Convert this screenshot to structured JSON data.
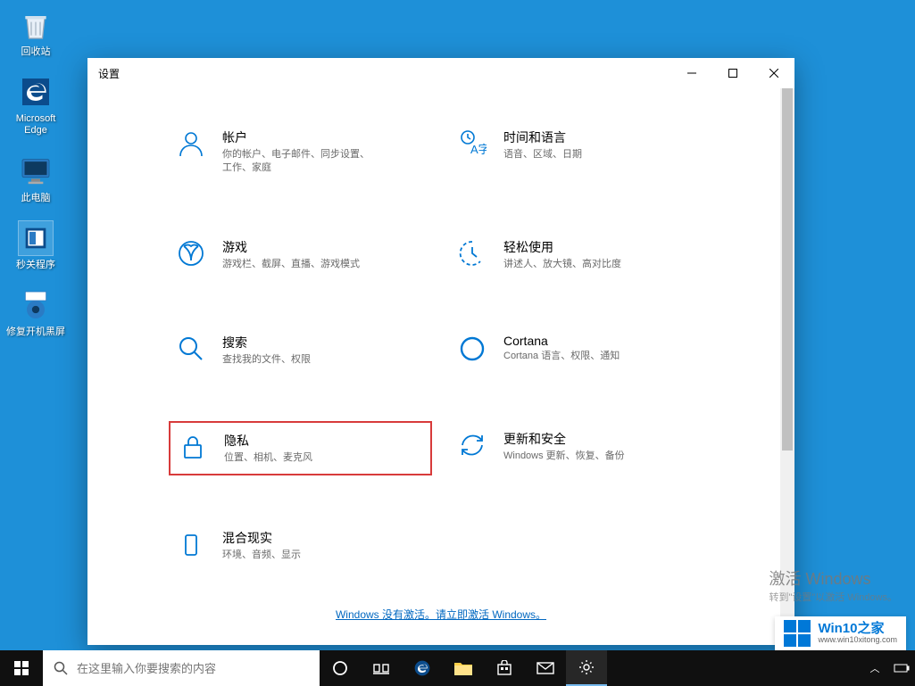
{
  "desktop": {
    "icons": [
      {
        "label": "回收站",
        "name": "recycle-bin"
      },
      {
        "label": "Microsoft\nEdge",
        "name": "edge"
      },
      {
        "label": "此电脑",
        "name": "this-pc"
      },
      {
        "label": "秒关程序",
        "name": "quick-close"
      },
      {
        "label": "修复开机黑屏",
        "name": "repair-boot"
      }
    ]
  },
  "settings": {
    "title": "设置",
    "categories": [
      {
        "title": "帐户",
        "desc": "你的帐户、电子邮件、同步设置、工作、家庭"
      },
      {
        "title": "时间和语言",
        "desc": "语音、区域、日期"
      },
      {
        "title": "游戏",
        "desc": "游戏栏、截屏、直播、游戏模式"
      },
      {
        "title": "轻松使用",
        "desc": "讲述人、放大镜、高对比度"
      },
      {
        "title": "搜索",
        "desc": "查找我的文件、权限"
      },
      {
        "title": "Cortana",
        "desc": "Cortana 语言、权限、通知"
      },
      {
        "title": "隐私",
        "desc": "位置、相机、麦克风"
      },
      {
        "title": "更新和安全",
        "desc": "Windows 更新、恢复、备份"
      },
      {
        "title": "混合现实",
        "desc": "环境、音频、显示"
      }
    ],
    "activation_text": "Windows 没有激活。请立即激活 Windows。"
  },
  "watermark": {
    "line1": "激活 Windows",
    "line2": "转到\"设置\"以激活 Windows。"
  },
  "brand": {
    "name": "Win10之家",
    "url": "www.win10xitong.com"
  },
  "taskbar": {
    "search_placeholder": "在这里输入你要搜索的内容"
  }
}
